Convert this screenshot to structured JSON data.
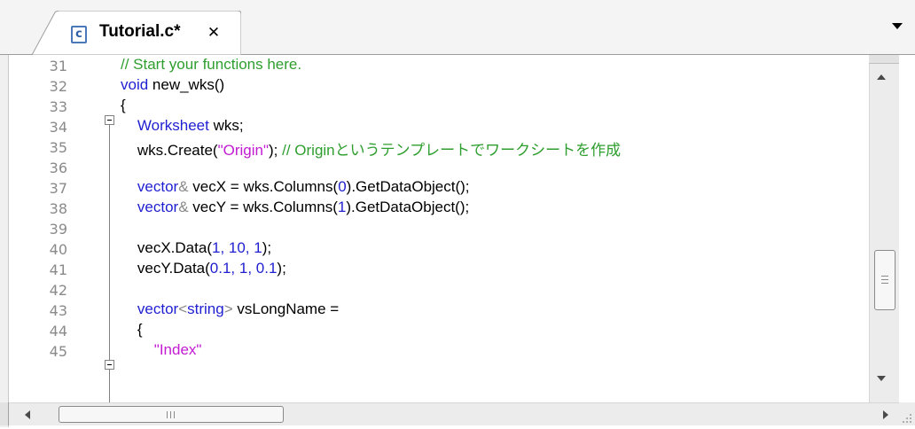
{
  "tab": {
    "icon_letter": "c",
    "label": "Tutorial.c*",
    "close_glyph": "✕"
  },
  "colors": {
    "comment": "#2e9e2e",
    "keyword": "#1f1fd1",
    "string": "#c21bd2",
    "number": "#1f1fd1",
    "line_number": "#8a8a8a"
  },
  "editor": {
    "line_numbers": [
      "31",
      "32",
      "33",
      "34",
      "35",
      "36",
      "37",
      "38",
      "39",
      "40",
      "41",
      "42",
      "43",
      "44",
      "45"
    ],
    "lines": [
      [
        {
          "t": "// Start your functions here.",
          "c": "cm"
        }
      ],
      [
        {
          "t": "void",
          "c": "kw"
        },
        {
          "t": " new_wks()"
        }
      ],
      [
        {
          "t": "{"
        }
      ],
      [
        {
          "t": "    "
        },
        {
          "t": "Worksheet",
          "c": "kw"
        },
        {
          "t": " wks;"
        }
      ],
      [
        {
          "t": "    wks.Create("
        },
        {
          "t": "\"Origin\"",
          "c": "str"
        },
        {
          "t": "); "
        },
        {
          "t": "// Originというテンプレートでワークシートを作成",
          "c": "cm"
        }
      ],
      [
        {
          "t": ""
        }
      ],
      [
        {
          "t": "    "
        },
        {
          "t": "vector",
          "c": "kw"
        },
        {
          "t": "&",
          "c": "punc"
        },
        {
          "t": " vecX = wks.Columns("
        },
        {
          "t": "0",
          "c": "num"
        },
        {
          "t": ").GetDataObject();"
        }
      ],
      [
        {
          "t": "    "
        },
        {
          "t": "vector",
          "c": "kw"
        },
        {
          "t": "&",
          "c": "punc"
        },
        {
          "t": " vecY = wks.Columns("
        },
        {
          "t": "1",
          "c": "num"
        },
        {
          "t": ").GetDataObject();"
        }
      ],
      [
        {
          "t": ""
        }
      ],
      [
        {
          "t": "    vecX.Data("
        },
        {
          "t": "1, 10, 1",
          "c": "num"
        },
        {
          "t": ");"
        }
      ],
      [
        {
          "t": "    vecY.Data("
        },
        {
          "t": "0.1, 1, 0.1",
          "c": "num"
        },
        {
          "t": ");"
        }
      ],
      [
        {
          "t": ""
        }
      ],
      [
        {
          "t": "    "
        },
        {
          "t": "vector",
          "c": "kw"
        },
        {
          "t": "<",
          "c": "punc"
        },
        {
          "t": "string",
          "c": "kw"
        },
        {
          "t": ">",
          "c": "punc"
        },
        {
          "t": " vsLongName ="
        }
      ],
      [
        {
          "t": "    {"
        }
      ],
      [
        {
          "t": "        "
        },
        {
          "t": "\"Index\"",
          "c": "str"
        }
      ]
    ]
  },
  "scrollbars": {
    "vertical_thumb_position_fraction": 0.6,
    "horizontal_thumb_position_fraction": 0.0
  }
}
